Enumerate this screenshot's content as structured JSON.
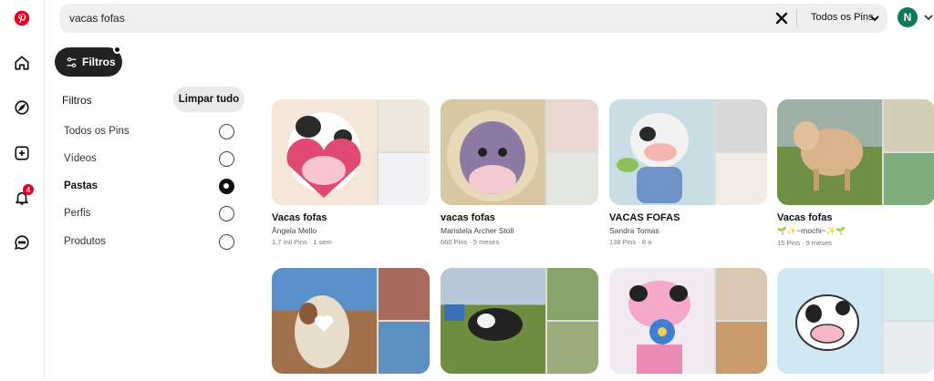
{
  "nav": {
    "items": [
      {
        "name": "pinterest-logo"
      },
      {
        "name": "home-icon"
      },
      {
        "name": "explore-icon"
      },
      {
        "name": "create-icon"
      },
      {
        "name": "notifications-icon",
        "badge": "4"
      },
      {
        "name": "messages-icon"
      }
    ],
    "accent": "#e60023"
  },
  "search": {
    "query": "vacas fofas",
    "scope": "Todos os Pins"
  },
  "account": {
    "initial": "N",
    "color": "#0e7a5d"
  },
  "filter_button": {
    "label": "Filtros"
  },
  "filter_panel": {
    "title": "Filtros",
    "clear_label": "Limpar tudo",
    "options": [
      {
        "label": "Todos os Pins",
        "selected": false
      },
      {
        "label": "Vídeos",
        "selected": false
      },
      {
        "label": "Pastas",
        "selected": true
      },
      {
        "label": "Perfis",
        "selected": false
      },
      {
        "label": "Produtos",
        "selected": false
      }
    ]
  },
  "boards": [
    {
      "name": "Vacas fofas",
      "owner": "Ângela Mello",
      "meta": "1,7 mil Pins · 1 sem"
    },
    {
      "name": "vacas fofas",
      "owner": "Maristela Archer Stoll",
      "meta": "660 Pins · 5 meses"
    },
    {
      "name": "VACAS FOFAS",
      "owner": "Sandra Tomas",
      "meta": "138 Pins · 8 a"
    },
    {
      "name": "Vacas fofas",
      "owner": "🌱✨~mochi~✨🌱",
      "meta": "15 Pins · 9 meses"
    },
    {
      "name": "",
      "owner": "",
      "meta": ""
    },
    {
      "name": "",
      "owner": "",
      "meta": ""
    },
    {
      "name": "",
      "owner": "",
      "meta": ""
    },
    {
      "name": "",
      "owner": "",
      "meta": ""
    }
  ]
}
